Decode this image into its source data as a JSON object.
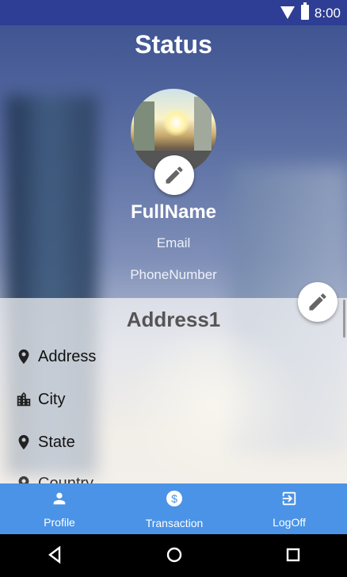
{
  "statusbar": {
    "time": "8:00",
    "wifi_icon": "wifi-icon",
    "battery_icon": "battery-icon"
  },
  "header": {
    "title": "Status",
    "full_name": "FullName",
    "email": "Email",
    "phone": "PhoneNumber"
  },
  "address": {
    "title": "Address1",
    "rows": [
      {
        "icon": "location-pin-icon",
        "label": "Address"
      },
      {
        "icon": "city-icon",
        "label": "City"
      },
      {
        "icon": "location-pin-icon",
        "label": "State"
      },
      {
        "icon": "location-pin-icon",
        "label": "Country"
      }
    ]
  },
  "bottom_nav": {
    "items": [
      {
        "icon": "person-icon",
        "label": "Profile"
      },
      {
        "icon": "dollar-icon",
        "label": "Transaction"
      },
      {
        "icon": "logout-icon",
        "label": "LogOff"
      }
    ]
  },
  "android_nav": {
    "back_icon": "back-triangle-icon",
    "home_icon": "home-circle-icon",
    "recent_icon": "recent-square-icon"
  },
  "colors": {
    "statusbar": "#2e3e94",
    "bottom_nav": "#4a93e6",
    "panel": "#f5f5f5"
  }
}
